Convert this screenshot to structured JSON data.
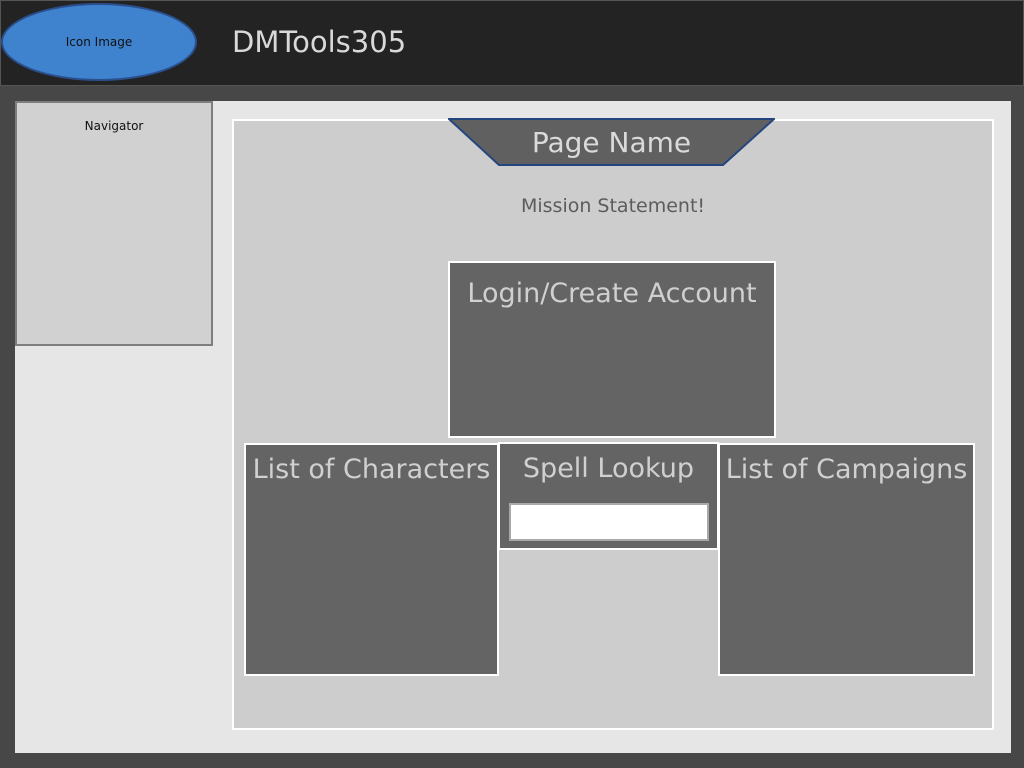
{
  "header": {
    "logo_label": "Icon Image",
    "app_title": "DMTools305"
  },
  "sidebar": {
    "navigator_label": "Navigator"
  },
  "main": {
    "page_name": "Page Name",
    "mission_statement": "Mission Statement!",
    "login_tile_label": "Login/Create Account",
    "characters_tile_label": "List of Characters",
    "spell_lookup": {
      "label": "Spell Lookup",
      "value": "",
      "placeholder": ""
    },
    "campaigns_tile_label": "List of Campaigns"
  },
  "colors": {
    "header_bg": "#232323",
    "logo_fill": "#3f83cf",
    "page_bg": "#474747",
    "content_bg": "#e6e6e6",
    "panel_bg": "#cdcdcd",
    "tile_bg": "#646464",
    "tab_fill": "#606060",
    "tab_border": "#25457f"
  }
}
